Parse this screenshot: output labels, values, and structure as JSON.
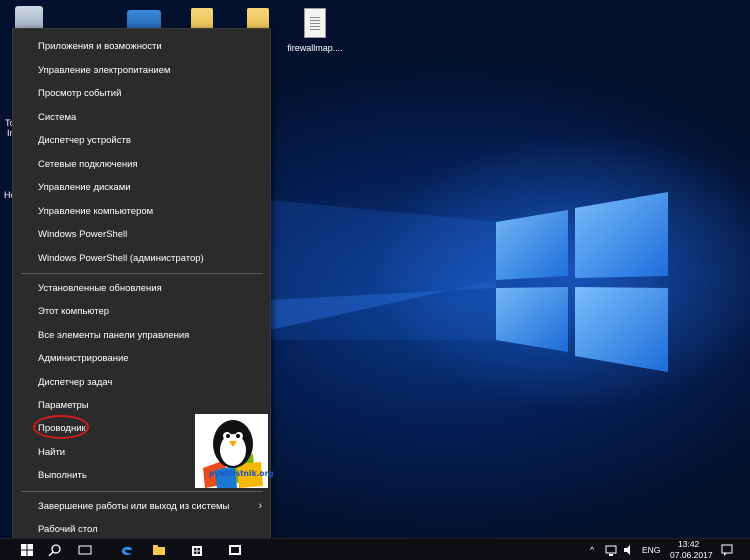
{
  "desktop": {
    "icons": [
      {
        "name": "recycle-bin",
        "label": ""
      },
      {
        "name": "app-shortcut",
        "label": ""
      },
      {
        "name": "folder-1",
        "label": ""
      },
      {
        "name": "folder-2",
        "label": ""
      },
      {
        "name": "firewall-file",
        "label": "firewallmap...."
      }
    ],
    "left_labels": [
      "To",
      "Ir",
      "He"
    ]
  },
  "context_menu": {
    "group1": [
      "Приложения и возможности",
      "Управление электропитанием",
      "Просмотр событий",
      "Система",
      "Диспетчер устройств",
      "Сетевые подключения",
      "Управление дисками",
      "Управление компьютером",
      "Windows PowerShell",
      "Windows PowerShell (администратор)"
    ],
    "group2": [
      "Установленные обновления",
      "Этот компьютер",
      "Все элементы панели управления",
      "Администрирование",
      "Диспетчер задач",
      "Параметры",
      "Проводник",
      "Найти",
      "Выполнить"
    ],
    "group3": [
      "Завершение работы или выход из системы",
      "Рабочий стол"
    ],
    "submenu_arrow": "›",
    "highlight_color": "#d01c1c"
  },
  "watermark": {
    "text": "pyatilistnik.org"
  },
  "taskbar": {
    "language": "ENG",
    "time": "13:42",
    "date": "07.06.2017"
  }
}
